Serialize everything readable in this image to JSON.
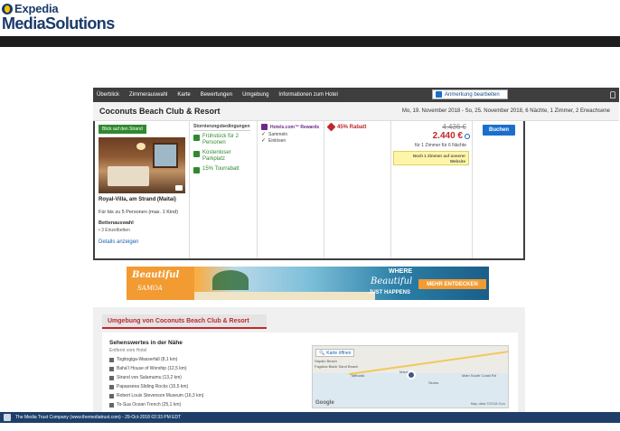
{
  "header": {
    "brand": "Expedia",
    "product": "MediaSolutions"
  },
  "nav": {
    "items": [
      "Überblick",
      "Zimmerauswahl",
      "Karte",
      "Bewertungen",
      "Umgebung",
      "Informationen zum Hotel"
    ],
    "note_button": "Anmerkung bearbeiten"
  },
  "hotel": {
    "name": "Coconuts Beach Club & Resort",
    "dates": "Mo, 19. November 2018 - So, 25. November 2018, 6 Nächte, 1 Zimmer, 2 Erwachsene"
  },
  "room": {
    "view_badge": "Blick auf den Strand",
    "name": "Royal-Villa, am Strand (Maitai)",
    "persons": "Für bis zu 5 Personen (max. 1 Kind)",
    "beds_label": "Bettenauswahl",
    "beds_value": "• 3 Einzelbetten",
    "details_link": "Details anzeigen"
  },
  "cancel": {
    "heading": "Stornierungsbedingungen",
    "amenities": [
      {
        "icon": "breakfast-icon",
        "label": "Frühstück für 2 Personen"
      },
      {
        "icon": "parking-icon",
        "label": "Kostenloser Parkplatz"
      },
      {
        "icon": "car-icon",
        "label": "15% Tourrabatt"
      }
    ]
  },
  "rewards": {
    "heading": "Hotels.com™ Rewards",
    "rows": [
      "Sammeln",
      "Einlösen"
    ]
  },
  "discount": {
    "label": "45% Rabatt"
  },
  "price": {
    "old": "4.436 €",
    "new": "2.440 €",
    "note": "für 1 Zimmer für 6 Nächte",
    "scarcity": "Noch 1 Zimmer auf unserer Website"
  },
  "book": {
    "label": "Buchen"
  },
  "ad": {
    "brand": "Beautiful",
    "sub": "SAMOA",
    "where": "WHERE",
    "beautiful": "Beautiful",
    "just": "JUST HAPPENS",
    "cta": "MEHR ENTDECKEN"
  },
  "surroundings": {
    "heading": "Umgebung von Coconuts Beach Club & Resort",
    "sights_title": "Sehenswertes in der Nähe",
    "sights_sub": "Entfernt vom Hotel",
    "sights": [
      "Togitogiga-Wasserfall (8,1 km)",
      "Bahá'í House of Worship (12,5 km)",
      "Strand von Salamumu (13,2 km)",
      "Papasseea Sliding Rocks (15,5 km)",
      "Robert Louis Stevenson Museum (16,3 km)",
      "To-Sua Ocean Trench (25,1 km)"
    ],
    "map": {
      "open_button": "Karte öffnen",
      "labels": [
        "Sapalo Beach",
        "Fagaloa Black Sand Beach",
        "Tafitoala",
        "Maninoa",
        "Siumu",
        "Main South Coast Rd"
      ],
      "brand": "Google",
      "data": "Map data ©2018 Goo"
    }
  },
  "footer": {
    "text": "The Media Trust Company (www.themediatrust.com) - 29-Oct-2018 02:33 PM EDT"
  }
}
